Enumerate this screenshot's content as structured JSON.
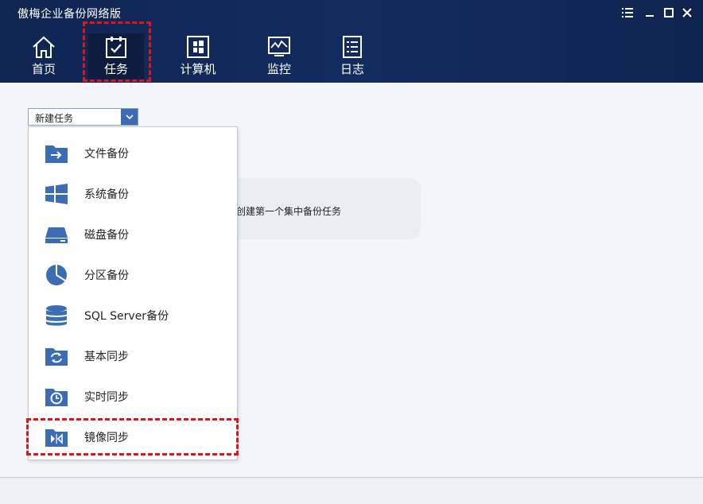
{
  "app": {
    "title": "傲梅企业备份网络版"
  },
  "window_controls": [
    "menu-icon",
    "minimize-icon",
    "maximize-icon",
    "close-icon"
  ],
  "nav": {
    "items": [
      {
        "label": "首页",
        "icon": "home-icon"
      },
      {
        "label": "任务",
        "icon": "task-icon",
        "active": true
      },
      {
        "label": "计算机",
        "icon": "computer-icon"
      },
      {
        "label": "监控",
        "icon": "monitor-icon"
      },
      {
        "label": "日志",
        "icon": "log-icon"
      }
    ]
  },
  "task_select": {
    "value": "新建任务"
  },
  "empty_state": {
    "text": "创建第一个集中备份任务"
  },
  "menu": {
    "items": [
      {
        "label": "文件备份",
        "icon": "file-backup-icon"
      },
      {
        "label": "系统备份",
        "icon": "system-backup-icon"
      },
      {
        "label": "磁盘备份",
        "icon": "disk-backup-icon"
      },
      {
        "label": "分区备份",
        "icon": "partition-backup-icon"
      },
      {
        "label": "SQL Server备份",
        "icon": "sql-server-backup-icon"
      },
      {
        "label": "基本同步",
        "icon": "basic-sync-icon"
      },
      {
        "label": "实时同步",
        "icon": "realtime-sync-icon"
      },
      {
        "label": "镜像同步",
        "icon": "mirror-sync-icon"
      }
    ]
  },
  "colors": {
    "header_bg": "#132c60",
    "accent": "#3b6cb4",
    "highlight": "#e0141b"
  }
}
